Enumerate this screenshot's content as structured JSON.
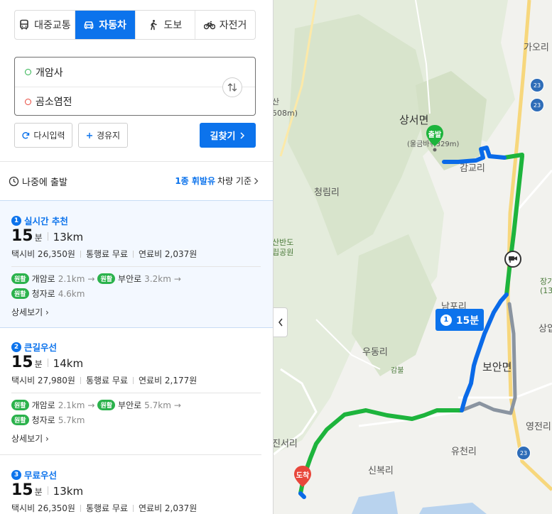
{
  "modes": [
    {
      "label": "대중교통",
      "icon": "bus-icon",
      "active": false
    },
    {
      "label": "자동차",
      "icon": "car-icon",
      "active": true
    },
    {
      "label": "도보",
      "icon": "walk-icon",
      "active": false
    },
    {
      "label": "자전거",
      "icon": "bicycle-icon",
      "active": false
    }
  ],
  "route": {
    "origin": "개암사",
    "destination": "곰소염전"
  },
  "actions": {
    "reset_label": "다시입력",
    "via_label": "경유지",
    "search_label": "길찾기"
  },
  "depart": {
    "later_label": "나중에 출발",
    "basis_highlight": "1종 휘발유",
    "basis_rest": "차량 기준"
  },
  "options": [
    {
      "num": "1",
      "title": "실시간 추천",
      "time": "15",
      "time_unit": "분",
      "distance": "13km",
      "taxi": "택시비 26,350원",
      "toll": "통행료 무료",
      "fuel": "연료비 2,037원",
      "roads": [
        {
          "badge": "원활",
          "name": "개암로",
          "km": "2.1km"
        },
        {
          "badge": "원활",
          "name": "부안로",
          "km": "3.2km"
        },
        {
          "badge": "원활",
          "name": "청자로",
          "km": "4.6km"
        }
      ],
      "detail": "상세보기"
    },
    {
      "num": "2",
      "title": "큰길우선",
      "time": "15",
      "time_unit": "분",
      "distance": "14km",
      "taxi": "택시비 27,980원",
      "toll": "통행료 무료",
      "fuel": "연료비 2,177원",
      "roads": [
        {
          "badge": "원활",
          "name": "개암로",
          "km": "2.1km"
        },
        {
          "badge": "원활",
          "name": "부안로",
          "km": "5.7km"
        },
        {
          "badge": "원활",
          "name": "청자로",
          "km": "5.7km"
        }
      ],
      "detail": "상세보기"
    },
    {
      "num": "3",
      "title": "무료우선",
      "time": "15",
      "time_unit": "분",
      "distance": "13km",
      "taxi": "택시비 26,350원",
      "toll": "통행료 무료",
      "fuel": "연료비 2,037원"
    }
  ],
  "map": {
    "labels": {
      "sangseomyeon": "상서면",
      "ulgeumba": "(울금바위329m)",
      "gamgyori": "감교리",
      "gaori": "가오리",
      "cheongrimri": "청림리",
      "namporri": "남포리",
      "udongri": "우동리",
      "gambul": "감불",
      "boanmyeon": "보안면",
      "jinseori": "진서리",
      "yucheonri": "유천리",
      "sinbokri": "신복리",
      "yeongjeonri": "영전리",
      "sangip": "상입",
      "san508": "산",
      "m508": "508m)",
      "sanbando": "산반도",
      "ripgongwon": "립공원",
      "janggi": "장기",
      "n13": "(13"
    },
    "route_badge": {
      "num": "1",
      "time": "15분"
    },
    "start_pin": "출발",
    "end_pin": "도착",
    "road_23": "23",
    "colors": {
      "primary": "#0c73ec",
      "route_green": "#1db43c",
      "route_blue": "#0a6ae8",
      "route_gray": "#8a94a0"
    }
  }
}
